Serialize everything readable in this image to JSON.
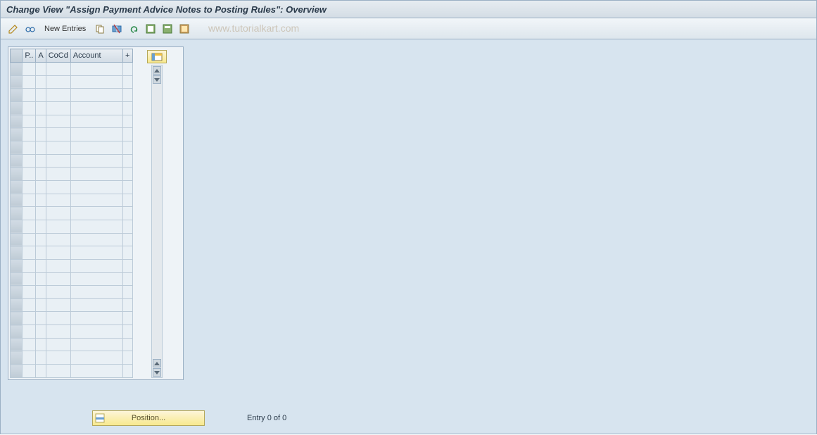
{
  "title": "Change View \"Assign Payment Advice Notes to Posting Rules\": Overview",
  "toolbar": {
    "new_entries_label": "New Entries"
  },
  "watermark": "www.tutorialkart.com",
  "table": {
    "headers": {
      "p": "P..",
      "a": "A",
      "cocd": "CoCd",
      "account": "Account",
      "plus": "+"
    },
    "row_count": 24
  },
  "footer": {
    "position_label": "Position...",
    "entry_text": "Entry 0 of 0"
  }
}
